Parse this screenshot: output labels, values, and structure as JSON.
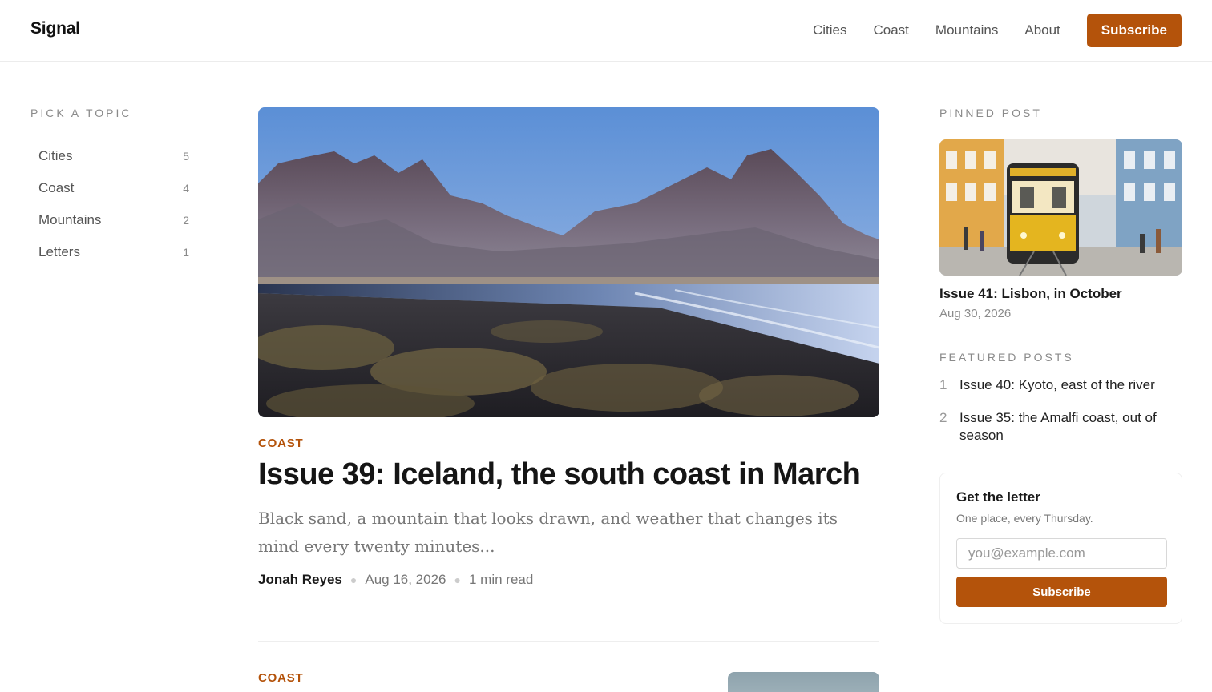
{
  "header": {
    "brand": "Signal",
    "nav": [
      "Cities",
      "Coast",
      "Mountains",
      "About"
    ],
    "subscribe_label": "Subscribe"
  },
  "topics": {
    "label": "PICK A TOPIC",
    "items": [
      {
        "name": "Cities",
        "count": "5"
      },
      {
        "name": "Coast",
        "count": "4"
      },
      {
        "name": "Mountains",
        "count": "2"
      },
      {
        "name": "Letters",
        "count": "1"
      }
    ]
  },
  "article": {
    "category": "COAST",
    "title": "Issue 39: Iceland, the south coast in March",
    "excerpt": "Black sand, a mountain that looks drawn, and weather that changes its mind every twenty minutes...",
    "author": "Jonah Reyes",
    "date": "Aug 16, 2026",
    "read_time": "1 min read",
    "image": "iceland-black-sand-beach-mountains"
  },
  "next_article": {
    "category": "COAST"
  },
  "sidebar": {
    "pinned_label": "PINNED POST",
    "pinned": {
      "title": "Issue 41: Lisbon, in October",
      "date": "Aug 30, 2026",
      "image": "lisbon-yellow-tram-street"
    },
    "featured_label": "FEATURED POSTS",
    "featured": [
      {
        "num": "1",
        "title": "Issue 40: Kyoto, east of the river"
      },
      {
        "num": "2",
        "title": "Issue 35: the Amalfi coast, out of season"
      }
    ]
  },
  "newsletter": {
    "title": "Get the letter",
    "subtitle": "One place, every Thursday.",
    "placeholder": "you@example.com",
    "button_label": "Subscribe"
  },
  "colors": {
    "accent": "#b4530b"
  }
}
